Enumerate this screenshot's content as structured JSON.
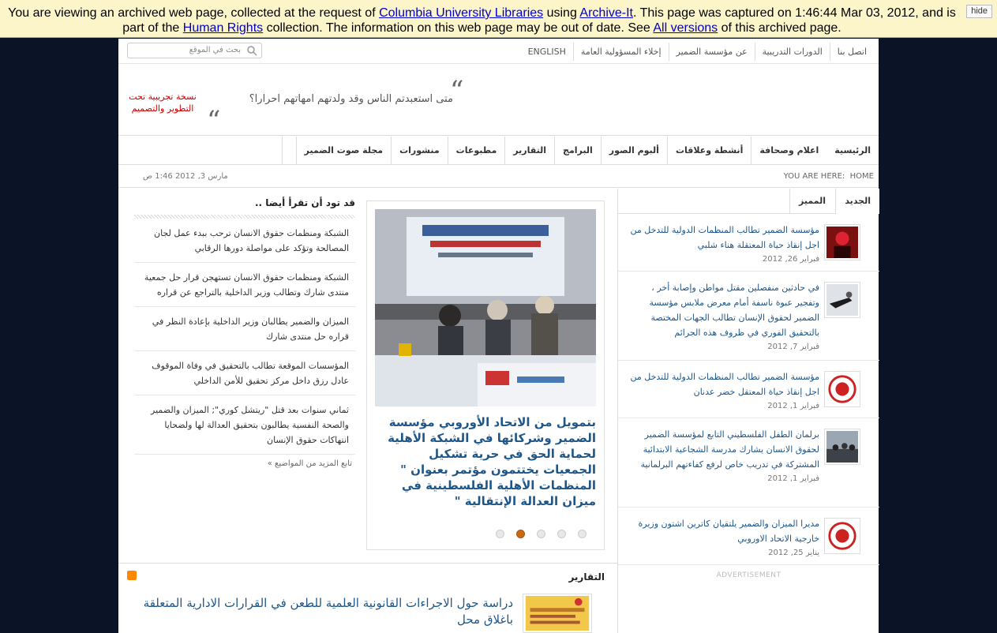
{
  "archive_banner": {
    "text_1": "You are viewing an archived web page, collected at the request of ",
    "link_1": "Columbia University Libraries",
    "text_2": " using ",
    "link_2": "Archive-It",
    "text_3": ". This page was captured on 1:46:44 Mar 03, 2012, and is part of the ",
    "link_3": "Human Rights",
    "text_4": " collection. The information on this web page may be out of date. See ",
    "link_4": "All versions",
    "text_5": " of this archived page.",
    "hide_label": "hide"
  },
  "topbar": {
    "links": [
      "ENGLISH",
      "إخلاء المسؤولية العامة",
      "عن مؤسسة الضمير",
      "الدورات التدريبية",
      "اتصل بنا"
    ],
    "search_placeholder": "بحث في الموقع"
  },
  "header": {
    "quote": "متى استعبدتم الناس وقد ولدتهم امهاتهم احرارا؟",
    "beta_notice": "نسخة تجريبية تحت التطوير والتصميم"
  },
  "main_nav": [
    "الرئيسية",
    "اعلام وصحافة",
    "أنشطة وعلاقات",
    "ألبوم الصور",
    "البرامج",
    "التقارير",
    "مطبوعات",
    "منشورات",
    "مجلة صوت الضمير"
  ],
  "breadcrumb": {
    "label": "YOU ARE HERE:",
    "home": "HOME",
    "date": "مارس 3, 2012 1:46 ص"
  },
  "more_like_this": {
    "title": "قد تود أن تقرأ أيضا ..",
    "items": [
      "الشبكة ومنظمات حقوق الانسان ترحب ببدء عمل لجان المصالحة وتؤكد على مواصلة دورها الرقابي",
      "الشبكة ومنظمات حقوق الانسان تستهجن قرار حل جمعية منتدى شارك وتطالب وزير الداخلية بالتراجع عن قراره",
      "الميزان والضمير يطالبان وزير الداخلية بإعادة النظر في قراره حل منتدى شارك",
      "المؤسسات الموقعة تطالب بالتحقيق في وفاة الموقوف عادل رزق داخل مركز تحقيق للأمن الداخلي",
      "ثماني سنوات بعد قتل \"ريتشل كوري\"; الميزان والضمير والصحة النفسية يطالبون بتحقيق العدالة لها ولضحايا انتهاكات حقوق الإنسان"
    ],
    "more_link": "تابع المزيد من المواضيع »"
  },
  "slider": {
    "caption": "بتمويل من الاتحاد الأوروبي مؤسسة الضمير وشركائها في الشبكة الأهلية لحماية الحق في حرية تشكيل الجمعيات يختتمون مؤتمر بعنوان \" المنظمات الأهلية الفلسطينية في ميزان العدالة الإنتقالية \"",
    "dot_count": 5,
    "active_dot": 2
  },
  "reports": {
    "title": "التقارير",
    "item_title": "دراسة حول الاجراءات القانونية العلمية للطعن في القرارات الادارية المتعلقة باغلاق محل"
  },
  "news_tabs": {
    "tabs": [
      "الجديد",
      "المميز"
    ],
    "items": [
      {
        "text": "مؤسسة الضمير تطالب المنظمات الدولية للتدخل من اجل إنقاذ حياة المعتقلة هناء شلبي",
        "date": "فبراير 26, 2012"
      },
      {
        "text": "في حادثين منفصلين مقتل مواطن وإصابة أخر ، وتفجير عبوة ناسفة أمام معرض ملابس مؤسسة الضمير لحقوق الإنسان تطالب الجهات المختصة بالتحقيق الفوري في ظروف هذه الجرائم",
        "date": "فبراير 7, 2012"
      },
      {
        "text": "مؤسسة الضمير تطالب المنظمات الدولية للتدخل من اجل إنقاذ حياة المعتقل خضر عدنان",
        "date": "فبراير 1, 2012"
      },
      {
        "text": "برلمان الطفل الفلسطيني التابع لمؤسسة الضمير لحقوق الانسان يشارك مدرسة الشجاعية الابتدائية المشتركة في تدريب خاص لرفع كفاءتهم البرلمانية",
        "date": "فبراير 1, 2012"
      },
      {
        "text": "مديرا الميزان والضمير يلتقيان كاترين اشتون وزيرة خارجية الاتحاد الاوروبي",
        "date": "يناير 25, 2012"
      }
    ],
    "advertisement": "ADVERTISEMENT"
  }
}
